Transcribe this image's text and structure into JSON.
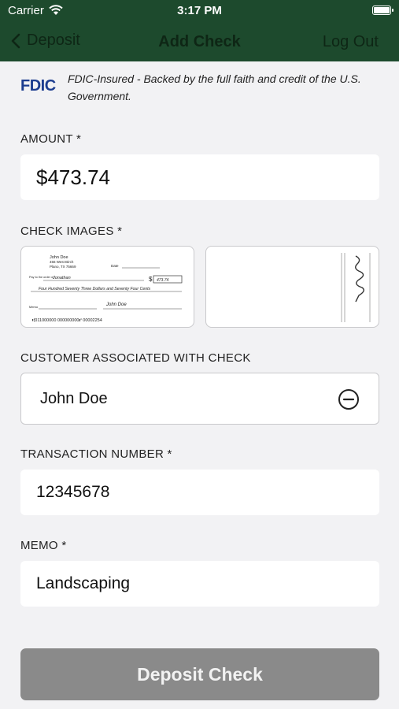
{
  "status_bar": {
    "carrier": "Carrier",
    "time": "3:17 PM"
  },
  "nav": {
    "back_label": "Deposit",
    "title": "Add Check",
    "logout_label": "Log Out"
  },
  "fdic": {
    "logo": "FDIC",
    "text": "FDIC-Insured - Backed by the full faith and credit of the U.S. Government."
  },
  "form": {
    "amount_label": "AMOUNT *",
    "amount_value": "$473.74",
    "check_images_label": "CHECK IMAGES *",
    "customer_label": "CUSTOMER ASSOCIATED WITH CHECK",
    "customer_value": "John Doe",
    "transaction_label": "TRANSACTION NUMBER *",
    "transaction_value": "12345678",
    "memo_label": "MEMO *",
    "memo_value": "Landscaping"
  },
  "check_front": {
    "name": "John Doe",
    "street": "456 West Birch",
    "city": "Plano, TX 75669",
    "date_label": "Date",
    "pay_to_label": "Pay to the order of",
    "pay_to": "Jonathan",
    "amount": "473.74",
    "written_amount": "Four Hundred Seventy Three Dollars and Seventy Four Cents",
    "memo_label": "Memo",
    "signature": "John Doe",
    "micr": "⑆011000000 000000000⑈ 00002254"
  },
  "submit_label": "Deposit Check"
}
